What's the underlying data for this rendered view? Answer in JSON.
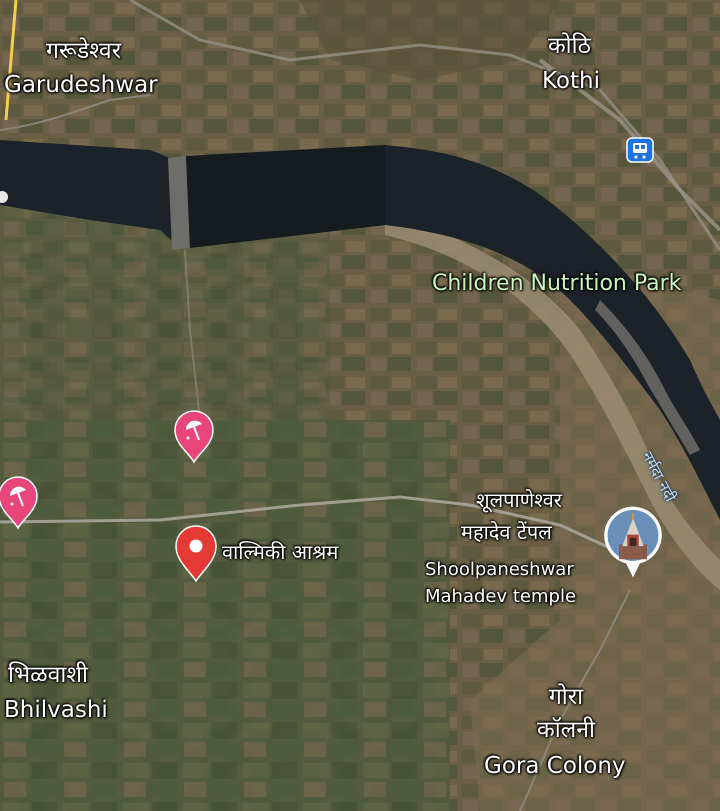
{
  "places": {
    "garudeshwar": {
      "local": "गरूडेश्वर",
      "latin": "Garudeshwar"
    },
    "kothi": {
      "local": "कोठि",
      "latin": "Kothi"
    },
    "bhilvashi": {
      "local": "भिळवाशी",
      "latin": "Bhilvashi"
    },
    "gora_colony": {
      "local": "गोरा कॉलनी",
      "latin": "Gora Colony"
    }
  },
  "pois": {
    "park": "Children Nutrition Park",
    "ashram": "वाल्मिकी आश्रम",
    "temple": {
      "local_line1": "शूलपाणेश्वर",
      "local_line2": "महादेव टेंपल",
      "latin_line1": "Shoolpaneshwar",
      "latin_line2": "Mahadev temple"
    }
  },
  "river": {
    "label": "नर्मदा नदी"
  },
  "colors": {
    "water": "#1c2229",
    "red_pin": "#e53935",
    "pink_pin": "#e8457a",
    "transit_badge": "#1a73e8",
    "park_text": "#c8f7c0"
  },
  "icons": [
    "transit-icon",
    "amusement-icon",
    "place-pin-icon",
    "temple-icon"
  ]
}
